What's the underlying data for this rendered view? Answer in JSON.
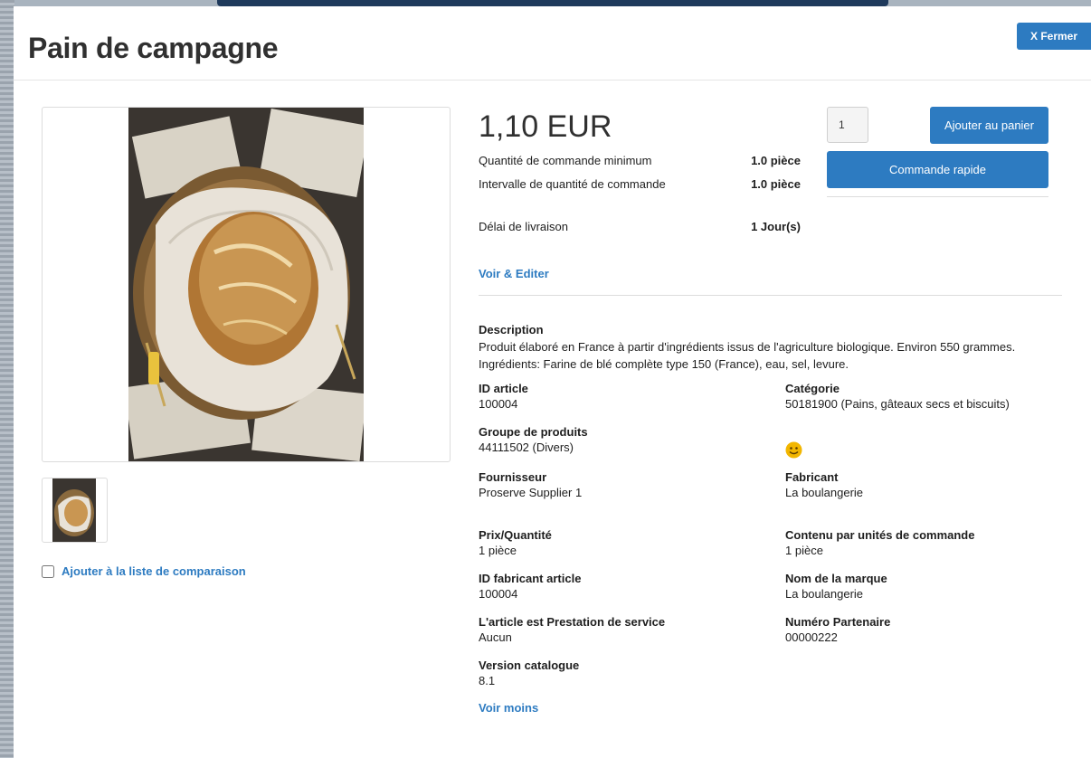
{
  "product": {
    "title": "Pain de campagne",
    "close_label": "X Fermer",
    "price": "1,10 EUR",
    "min_qty_label": "Quantité de commande minimum",
    "min_qty_value": "1.0 pièce",
    "interval_label": "Intervalle de quantité de commande",
    "interval_value": "1.0 pièce",
    "delivery_label": "Délai de livraison",
    "delivery_value": "1 Jour(s)",
    "edit_link": "Voir & Editer",
    "quantity_value": "1",
    "add_to_cart_label": "Ajouter au panier",
    "quick_order_label": "Commande rapide",
    "compare_label": "Ajouter à la liste de comparaison",
    "description_title": "Description",
    "description_text": "Produit élaboré en France à partir d'ingrédients issus de l'agriculture biologique. Environ 550 grammes. Ingrédients: Farine de blé complète type 150 (France), eau, sel, levure.",
    "see_less_link": "Voir moins"
  },
  "attributes": {
    "article_id": {
      "label": "ID article",
      "value": "100004"
    },
    "category": {
      "label": "Catégorie",
      "value": "50181900 (Pains, gâteaux secs et biscuits)"
    },
    "product_group": {
      "label": "Groupe de produits",
      "value": "44111502 (Divers)"
    },
    "supplier": {
      "label": "Fournisseur",
      "value": "Proserve Supplier 1"
    },
    "manufacturer": {
      "label": "Fabricant",
      "value": "La boulangerie"
    },
    "price_qty": {
      "label": "Prix/Quantité",
      "value": "1 pièce"
    },
    "content_per_unit": {
      "label": "Contenu par unités de commande",
      "value": "1 pièce"
    },
    "manufacturer_article_id": {
      "label": "ID fabricant article",
      "value": "100004"
    },
    "brand_name": {
      "label": "Nom de la marque",
      "value": "La boulangerie"
    },
    "service": {
      "label": "L'article est Prestation de service",
      "value": "Aucun"
    },
    "partner_number": {
      "label": "Numéro Partenaire",
      "value": "00000222"
    },
    "catalog_version": {
      "label": "Version catalogue",
      "value": "8.1"
    }
  },
  "icons": {
    "rating": "smiley-icon"
  },
  "colors": {
    "accent": "#2d7bc1",
    "header_bar": "#1f3a5c",
    "smiley": "#f2b600"
  }
}
